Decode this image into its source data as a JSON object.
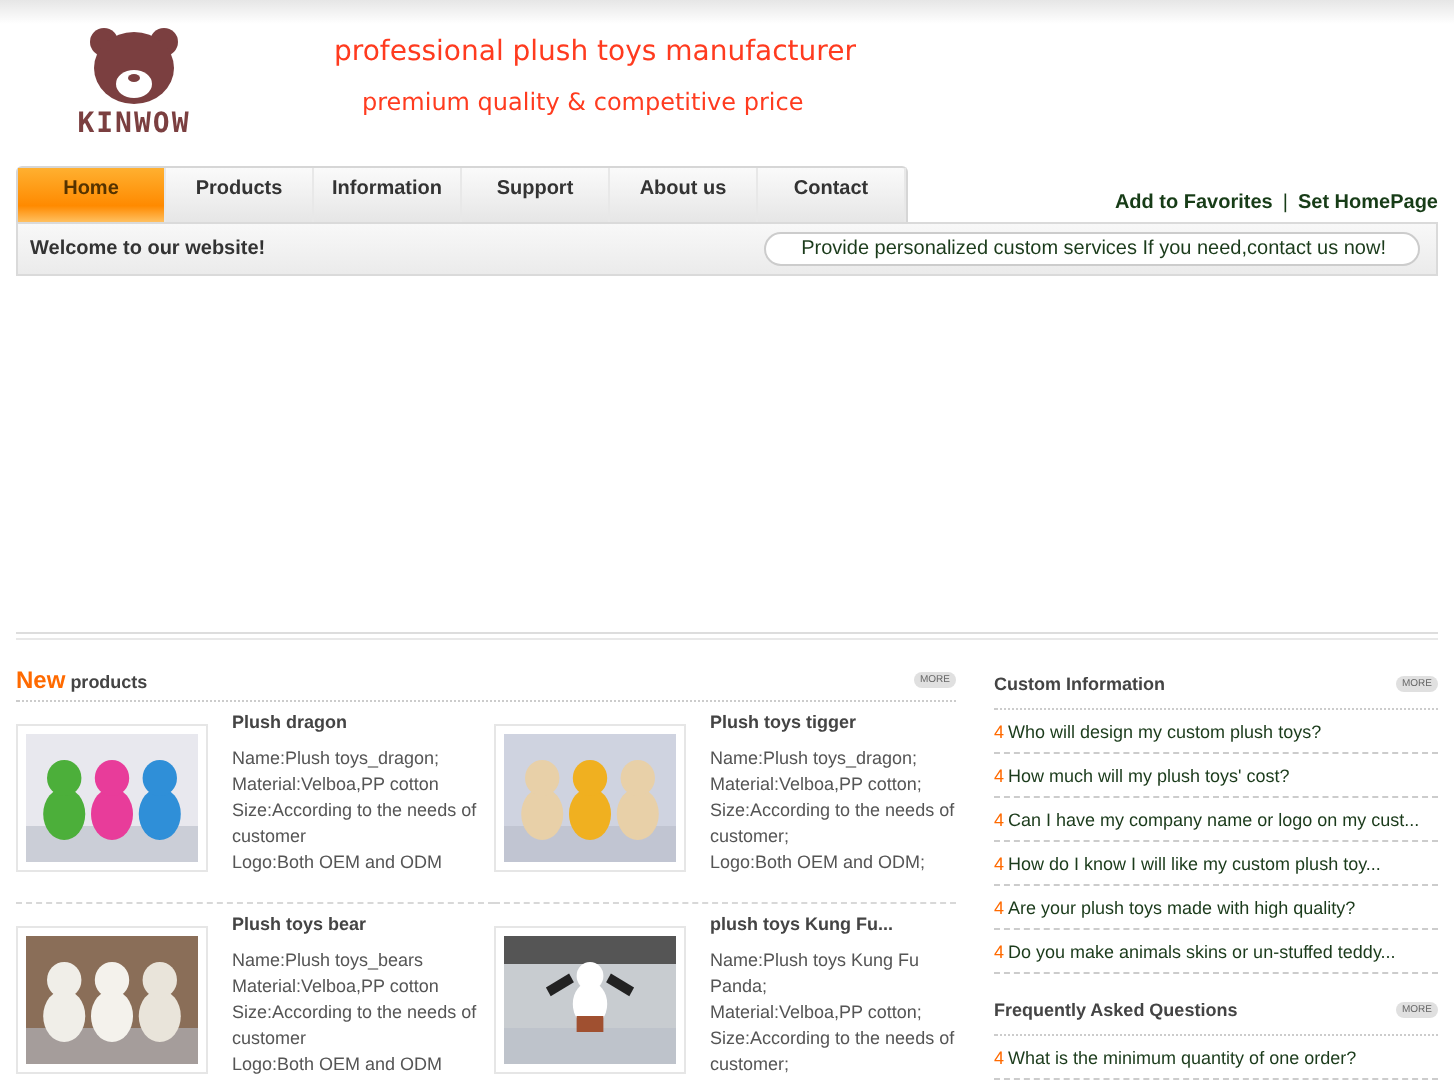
{
  "logo": {
    "text": "KINWOW"
  },
  "header": {
    "tagline": "professional plush toys manufacturer",
    "subtagline": "premium quality & competitive price"
  },
  "nav": [
    {
      "label": "Home",
      "selected": true
    },
    {
      "label": "Products",
      "selected": false
    },
    {
      "label": "Information",
      "selected": false
    },
    {
      "label": "Support",
      "selected": false
    },
    {
      "label": "About us",
      "selected": false
    },
    {
      "label": "Contact",
      "selected": false
    }
  ],
  "top_links": [
    "Add to Favorites",
    "|",
    "Set HomePage"
  ],
  "welcome": "Welcome to our website!",
  "notice": "Provide personalized custom services If you need,contact us now!",
  "new_products": {
    "title_accent": "New",
    "title": "products",
    "more": "MORE",
    "items": [
      {
        "name": "Plush dragon",
        "details": [
          "Name:Plush toys_dragon;",
          "Material:Velboa,PP cotton",
          "Size:According to the needs of customer",
          "Logo:Both OEM and ODM"
        ]
      },
      {
        "name": "Plush toys tigger",
        "details": [
          "Name:Plush toys_dragon;",
          "Material:Velboa,PP cotton;",
          "Size:According to the needs of customer;",
          "Logo:Both OEM and ODM;"
        ]
      },
      {
        "name": "Plush toys bear",
        "details": [
          "Name:Plush toys_bears",
          "Material:Velboa,PP cotton",
          "Size:According to the needs of customer",
          "Logo:Both OEM and ODM"
        ]
      },
      {
        "name": "plush toys Kung Fu...",
        "details": [
          "Name:Plush toys Kung Fu Panda;",
          "Material:Velboa,PP cotton;",
          "Size:According to the needs of customer;"
        ]
      }
    ]
  },
  "sidebar": [
    {
      "title": "Custom Information",
      "more": "MORE",
      "items": [
        {
          "bullet": "4",
          "text": "Who will design my custom plush toys?"
        },
        {
          "bullet": "4",
          "text": "How much will my plush toys' cost?"
        },
        {
          "bullet": "4",
          "text": "Can I have my company name or logo on my cust..."
        },
        {
          "bullet": "4",
          "text": "How do I know I will like my custom plush toy..."
        },
        {
          "bullet": "4",
          "text": "Are your plush toys made with high quality?"
        },
        {
          "bullet": "4",
          "text": "Do you make animals skins or un-stuffed teddy..."
        }
      ]
    },
    {
      "title": "Frequently Asked Questions",
      "more": "MORE",
      "items": [
        {
          "bullet": "4",
          "text": "What is the minimum quantity of one order?"
        }
      ]
    }
  ]
}
